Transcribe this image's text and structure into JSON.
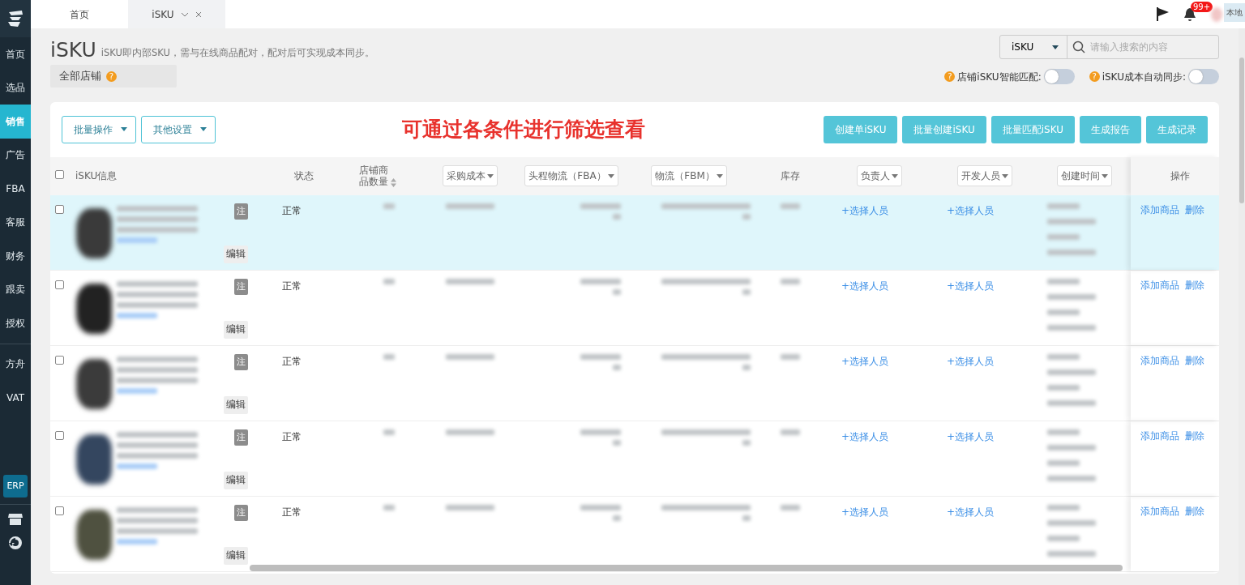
{
  "sidebar": {
    "groups": [
      [
        {
          "label": "首页",
          "selected": false,
          "kind": "text"
        },
        {
          "label": "选品",
          "selected": false,
          "kind": "text"
        },
        {
          "label": "销售",
          "selected": true,
          "kind": "text"
        },
        {
          "label": "广告",
          "selected": false,
          "kind": "text"
        },
        {
          "label": "FBA",
          "selected": false,
          "kind": "text"
        },
        {
          "label": "客服",
          "selected": false,
          "kind": "text"
        },
        {
          "label": "财务",
          "selected": false,
          "kind": "text"
        },
        {
          "label": "跟卖",
          "selected": false,
          "kind": "text"
        },
        {
          "label": "授权",
          "selected": false,
          "kind": "text"
        }
      ],
      [
        {
          "label": "方舟",
          "selected": false,
          "kind": "text"
        },
        {
          "label": "VAT",
          "selected": false,
          "kind": "text"
        },
        {
          "label": "ERP",
          "selected": false,
          "kind": "badge"
        }
      ]
    ]
  },
  "tabs": [
    {
      "label": "首页",
      "selected": false,
      "closable": false
    },
    {
      "label": "iSKU",
      "selected": true,
      "closable": true
    }
  ],
  "header": {
    "notification_badge": "99+",
    "user_label": "本地"
  },
  "page": {
    "title": "iSKU",
    "subtitle": "iSKU即内部SKU，需与在线商品配对，配对后可实现成本同步。",
    "store_filter": "全部店铺",
    "store_help": "?"
  },
  "search": {
    "scope": "iSKU",
    "placeholder": "请输入搜索的内容"
  },
  "toggles": [
    {
      "help": "?",
      "label": "店铺iSKU智能匹配:",
      "on": false
    },
    {
      "help": "?",
      "label": "iSKU成本自动同步:",
      "on": false
    }
  ],
  "annotation": "可通过各条件进行筛选查看",
  "dropdown_buttons": [
    "批量操作",
    "其他设置"
  ],
  "action_buttons": [
    "创建单iSKU",
    "批量创建iSKU",
    "批量匹配iSKU",
    "生成报告",
    "生成记录"
  ],
  "table": {
    "select_all_checked": false,
    "columns": [
      {
        "label": "iSKU信息",
        "kind": "plain"
      },
      {
        "label": "状态",
        "kind": "plain"
      },
      {
        "label": "店铺商品数量",
        "kind": "sortable"
      },
      {
        "label": "采购成本",
        "kind": "filter"
      },
      {
        "label": "头程物流（FBA）",
        "kind": "filter"
      },
      {
        "label": "物流（FBM）",
        "kind": "filter"
      },
      {
        "label": "库存",
        "kind": "plain"
      },
      {
        "label": "负责人",
        "kind": "filter"
      },
      {
        "label": "开发人员",
        "kind": "filter"
      },
      {
        "label": "创建时间",
        "kind": "filter"
      },
      {
        "label": "操作",
        "kind": "plain"
      }
    ],
    "rows": [
      {
        "selected": true,
        "checked": false,
        "note_tag": "注",
        "edit_label": "编辑",
        "status": "正常",
        "owner": "+选择人员",
        "developer": "+选择人员",
        "actions": [
          "添加商品",
          "删除"
        ]
      },
      {
        "selected": false,
        "checked": false,
        "note_tag": "注",
        "edit_label": "编辑",
        "status": "正常",
        "owner": "+选择人员",
        "developer": "+选择人员",
        "actions": [
          "添加商品",
          "删除"
        ]
      },
      {
        "selected": false,
        "checked": false,
        "note_tag": "注",
        "edit_label": "编辑",
        "status": "正常",
        "owner": "+选择人员",
        "developer": "+选择人员",
        "actions": [
          "添加商品",
          "删除"
        ]
      },
      {
        "selected": false,
        "checked": false,
        "note_tag": "注",
        "edit_label": "编辑",
        "status": "正常",
        "owner": "+选择人员",
        "developer": "+选择人员",
        "actions": [
          "添加商品",
          "删除"
        ]
      },
      {
        "selected": false,
        "checked": false,
        "note_tag": "注",
        "edit_label": "编辑",
        "status": "正常",
        "owner": "+选择人员",
        "developer": "+选择人员",
        "actions": [
          "添加商品",
          "删除"
        ]
      }
    ]
  }
}
